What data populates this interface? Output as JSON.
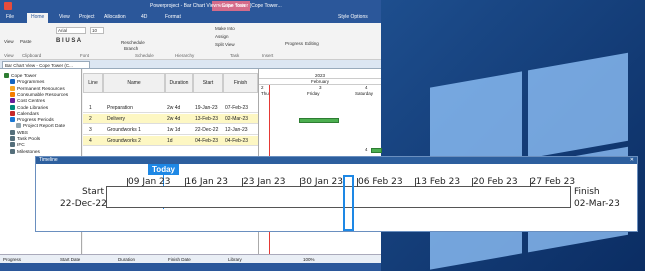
{
  "app": {
    "title": "Powerproject - Bar Chart View - Cope Tower (Cope Tower...",
    "contextual_tab": "Timeline Tools",
    "ribbon_tabs": [
      "File",
      "Home",
      "View",
      "Project",
      "Allocation",
      "4D",
      "Format"
    ],
    "active_tab": "Home",
    "style_options": "Style Options",
    "ribbon": {
      "view_label": "View",
      "clipboard_label": "Clipboard",
      "paste_label": "Paste",
      "font_label": "Font",
      "font_name": "Arial",
      "font_size": "10",
      "schedule_label": "Schedule",
      "reschedule_label": "Reschedule",
      "branch_label": "Branch",
      "hierarchy_label": "Hierarchy",
      "task_label": "Task",
      "make_into_label": "Make Into",
      "assign_label": "Assign",
      "split_view_label": "Split View",
      "insert_label": "Insert",
      "progress_label": "Progress",
      "editing_label": "Editing"
    },
    "document_tab": "Bar Chart View - Cope Tower (C..."
  },
  "tree": {
    "items": [
      {
        "label": "Cope Tower",
        "indent": 0,
        "color": "#2e7d32"
      },
      {
        "label": "Programmes",
        "indent": 1,
        "color": "#1565c0"
      },
      {
        "label": "Permanent Resources",
        "indent": 1,
        "color": "#f9a825"
      },
      {
        "label": "Consumable Resources",
        "indent": 1,
        "color": "#f57c00"
      },
      {
        "label": "Cost Centres",
        "indent": 1,
        "color": "#6a1b9a"
      },
      {
        "label": "Code Libraries",
        "indent": 1,
        "color": "#00897b"
      },
      {
        "label": "Calendars",
        "indent": 1,
        "color": "#c62828"
      },
      {
        "label": "Progress Periods",
        "indent": 1,
        "color": "#1976d2"
      },
      {
        "label": "Project Report Date",
        "indent": 2,
        "color": "#90a4ae"
      },
      {
        "label": "WBS",
        "indent": 1,
        "color": "#546e7a"
      },
      {
        "label": "Task Pools",
        "indent": 1,
        "color": "#546e7a"
      },
      {
        "label": "IFC",
        "indent": 1,
        "color": "#546e7a"
      },
      {
        "label": "Milestones",
        "indent": 1,
        "color": "#546e7a"
      }
    ]
  },
  "grid": {
    "columns": [
      "Line",
      "Name",
      "Duration",
      "Start",
      "Finish"
    ],
    "rows": [
      {
        "line": "1",
        "name": "Preparation",
        "duration": "2w 4d",
        "start": "19-Jan-23",
        "finish": "07-Feb-23",
        "highlight": false
      },
      {
        "line": "2",
        "name": "Delivery",
        "duration": "2w 4d",
        "start": "13-Feb-23",
        "finish": "02-Mar-23",
        "highlight": true
      },
      {
        "line": "3",
        "name": "Groundworks 1",
        "duration": "1w 1d",
        "start": "22-Dec-22",
        "finish": "12-Jan-23",
        "highlight": false
      },
      {
        "line": "4",
        "name": "Groundworks 2",
        "duration": "1d",
        "start": "04-Feb-23",
        "finish": "04-Feb-23",
        "highlight": true
      }
    ]
  },
  "gantt": {
    "year": "2023",
    "month": "February",
    "days": [
      "2",
      "3",
      "4"
    ],
    "day_names": [
      "Thu",
      "Friday",
      "Saturday"
    ]
  },
  "timeline": {
    "title": "Timeline",
    "today_label": "Today",
    "start_label": "Start",
    "start_date": "22-Dec-22",
    "finish_label": "Finish",
    "finish_date": "02-Mar-23",
    "ticks": [
      "09 Jan 23",
      "16 Jan 23",
      "23 Jan 23",
      "30 Jan 23",
      "06 Feb 23",
      "13 Feb 23",
      "20 Feb 23",
      "27 Feb 23"
    ]
  },
  "statusbar": {
    "progress": "Progress",
    "start_date": "Start Date",
    "duration": "Duration",
    "finish_date": "Finish Date",
    "library": "Library",
    "zoom": "100%"
  }
}
